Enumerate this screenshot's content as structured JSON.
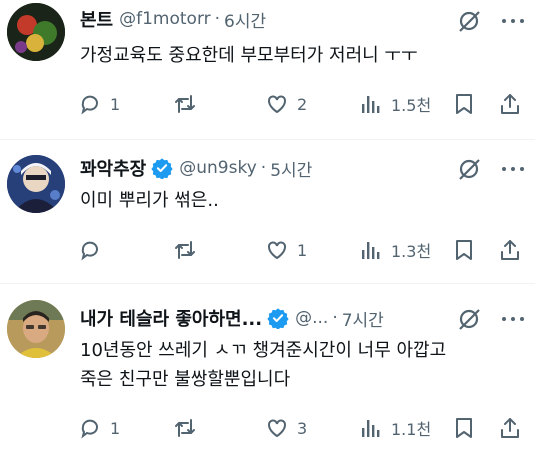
{
  "tweets": [
    {
      "name": "본트",
      "handle": "@f1motorr",
      "verified": false,
      "time": "6시간",
      "text": [
        "가정교육도 중요한데 부모부터가 저러니 ㅜㅜ"
      ],
      "stats": {
        "replies": "1",
        "retweets": "",
        "likes": "2",
        "views": "1.5천"
      }
    },
    {
      "name": "꽈악추장",
      "handle": "@un9sky",
      "verified": true,
      "time": "5시간",
      "text": [
        "이미 뿌리가 썪은.."
      ],
      "stats": {
        "replies": "",
        "retweets": "",
        "likes": "1",
        "views": "1.3천"
      }
    },
    {
      "name": "내가 테슬라 좋아하면...",
      "handle": "@...",
      "verified": true,
      "time": "7시간",
      "text": [
        "10년동안 쓰레기 ㅅㄲ 챙겨준시간이 너무 아깝고",
        "죽은 친구만 불쌍할뿐입니다"
      ],
      "stats": {
        "replies": "1",
        "retweets": "",
        "likes": "3",
        "views": "1.1천"
      }
    }
  ],
  "separator": "·",
  "colors": {
    "text": "#0f1419",
    "secondary": "#536471",
    "verified": "#1d9bf0",
    "divider": "#eff3f4"
  },
  "icons": [
    "grok-icon",
    "more-icon",
    "reply-icon",
    "retweet-icon",
    "like-icon",
    "views-icon",
    "bookmark-icon",
    "share-icon",
    "verified-badge-icon"
  ]
}
